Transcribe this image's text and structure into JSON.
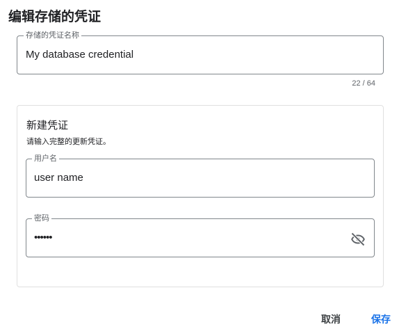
{
  "dialog": {
    "title": "编辑存储的凭证"
  },
  "credential_name": {
    "label": "存储的凭证名称",
    "value": "My database credential",
    "counter": "22 / 64"
  },
  "new_credential": {
    "title": "新建凭证",
    "hint": "请输入完整的更新凭证。",
    "username": {
      "label": "用户名",
      "value": "user name"
    },
    "password": {
      "label": "密码",
      "value": "••••••",
      "toggle_icon": "visibility-off-icon"
    }
  },
  "actions": {
    "cancel_label": "取消",
    "save_label": "保存"
  },
  "colors": {
    "accent": "#1a73e8",
    "border": "#80868b"
  }
}
